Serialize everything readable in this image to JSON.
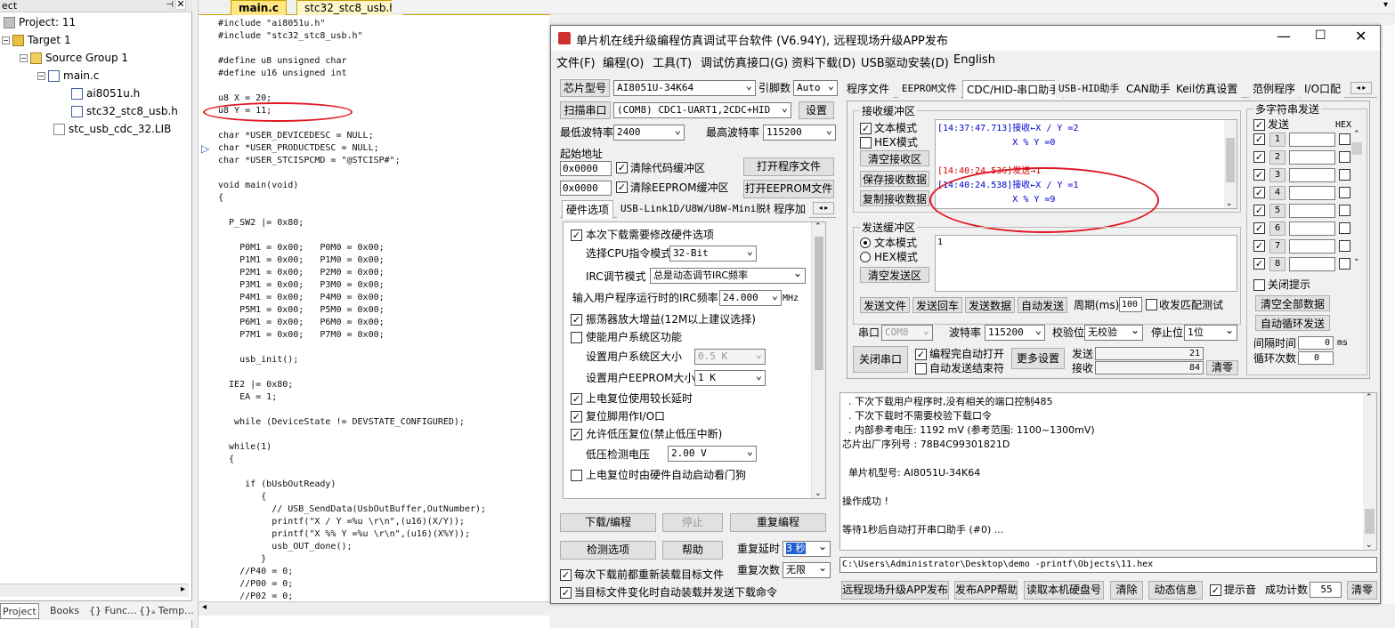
{
  "project": {
    "header": "ect",
    "items": [
      "Project: 11",
      "Target 1",
      "Source Group 1",
      "main.c",
      "ai8051u.h",
      "stc32_stc8_usb.h",
      "stc_usb_cdc_32.LIB"
    ],
    "tabs": [
      "Project",
      "Books",
      "{} Func...",
      "{}ₐ Temp..."
    ]
  },
  "editor": {
    "tabs": [
      "main.c",
      "stc32_stc8_usb.h"
    ],
    "lines": [
      "#include \"ai8051u.h\"",
      "#include \"stc32_stc8_usb.h\"",
      "",
      "#define u8 unsigned char",
      "#define u16 unsigned int",
      "",
      "u8 X = 20;",
      "u8 Y = 11;",
      "",
      "char *USER_DEVICEDESC = NULL;",
      "char *USER_PRODUCTDESC = NULL;",
      "char *USER_STCISPCMD = \"@STCISP#\";",
      "",
      "void main(void)",
      "{",
      "",
      "  P_SW2 |= 0x80;",
      "",
      "    P0M1 = 0x00;   P0M0 = 0x00;",
      "    P1M1 = 0x00;   P1M0 = 0x00;",
      "    P2M1 = 0x00;   P2M0 = 0x00;",
      "    P3M1 = 0x00;   P3M0 = 0x00;",
      "    P4M1 = 0x00;   P4M0 = 0x00;",
      "    P5M1 = 0x00;   P5M0 = 0x00;",
      "    P6M1 = 0x00;   P6M0 = 0x00;",
      "    P7M1 = 0x00;   P7M0 = 0x00;",
      "",
      "    usb_init();",
      "",
      "  IE2 |= 0x80;",
      "    EA = 1;",
      "",
      "   while (DeviceState != DEVSTATE_CONFIGURED);",
      "",
      "  while(1)",
      "  {",
      "",
      "     if (bUsbOutReady)",
      "        {",
      "          // USB_SendData(UsbOutBuffer,OutNumber);",
      "          printf(\"X / Y =%u \\r\\n\",(u16)(X/Y));",
      "          printf(\"X %% Y =%u \\r\\n\",(u16)(X%Y));",
      "          usb_OUT_done();",
      "        }",
      "    //P40 = 0;",
      "    //P00 = 0;",
      "    //P02 = 0;"
    ]
  },
  "window": {
    "title": "单片机在线升级编程仿真调试平台软件 (V6.94Y), 远程现场升级APP发布",
    "menus": [
      "文件(F)",
      "编程(O)",
      "工具(T)",
      "调试仿真接口(G)",
      "资料下载(D)",
      "USB驱动安装(D)",
      "English"
    ]
  },
  "left": {
    "chip_label": "芯片型号",
    "chip": "AI8051U-34K64",
    "pins_label": "引脚数",
    "pins": "Auto",
    "scan_btn": "扫描串口",
    "port": "(COM8) CDC1-UART1,2CDC+HID",
    "settings_btn": "设置",
    "min_baud_label": "最低波特率",
    "min_baud": "2400",
    "max_baud_label": "最高波特率",
    "max_baud": "115200",
    "start_label": "起始地址",
    "addr1": "0x0000",
    "clear_code": "清除代码缓冲区",
    "open_prog": "打开程序文件",
    "addr2": "0x0000",
    "clear_eeprom": "清除EEPROM缓冲区",
    "open_eeprom": "打开EEPROM文件",
    "tabs": [
      "硬件选项",
      "USB-Link1D/U8W/U8W-Mini脱机",
      "程序加"
    ],
    "hw": {
      "opt1": "本次下载需要修改硬件选项",
      "cpu_label": "选择CPU指令模式",
      "cpu": "32-Bit",
      "irc_label": "IRC调节模式",
      "irc": "总是动态调节IRC频率",
      "freq_label": "输入用户程序运行时的IRC频率",
      "freq": "24.000",
      "freq_unit": "MHz",
      "osc": "振荡器放大增益(12M以上建议选择)",
      "sysarea": "使能用户系统区功能",
      "sys_size_label": "设置用户系统区大小",
      "sys_size": "0.5 K",
      "eeprom_label": "设置用户EEPROM大小",
      "eeprom": "1   K",
      "power_delay": "上电复位使用较长延时",
      "reset_io": "复位脚用作I/O口",
      "lowv": "允许低压复位(禁止低压中断)",
      "lowv_label": "低压检测电压",
      "lowv_val": "2.00 V",
      "watchdog": "上电复位时由硬件自动启动看门狗"
    },
    "download_btn": "下载/编程",
    "stop_btn": "停止",
    "reprog_btn": "重复编程",
    "check_btn": "检测选项",
    "help_btn": "帮助",
    "delay_label": "重复延时",
    "delay": "3 秒",
    "count_label": "重复次数",
    "count": "无限",
    "reload1": "每次下载前都重新装载目标文件",
    "reload2": "当目标文件变化时自动装载并发送下载命令"
  },
  "right": {
    "tabs": [
      "程序文件",
      "EEPROM文件",
      "CDC/HID-串口助手",
      "USB-HID助手",
      "CAN助手",
      "Keil仿真设置",
      "范例程序",
      "I/O口配"
    ],
    "recv_group": "接收缓冲区",
    "text_mode": "文本模式",
    "hex_mode": "HEX模式",
    "clear_recv": "清空接收区",
    "save_recv": "保存接收数据",
    "copy_recv": "复制接收数据",
    "recv_lines": [
      {
        "text": "[14:37:47.713]接收←X / Y =2",
        "color": "#0000cc"
      },
      {
        "text": "              X % Y =0",
        "color": "#0000cc"
      },
      {
        "text": "",
        "color": "#000"
      },
      {
        "text": "[14:40:24.536]发送→1",
        "color": "#cc0000"
      },
      {
        "text": "[14:40:24.538]接收←X / Y =1",
        "color": "#0000cc"
      },
      {
        "text": "              X % Y =9",
        "color": "#0000cc"
      }
    ],
    "send_group": "发送缓冲区",
    "clear_send": "清空发送区",
    "send_text": "1",
    "send_file": "发送文件",
    "send_enter": "发送回车",
    "send_data": "发送数据",
    "auto_send": "自动发送",
    "period_label": "周期(ms)",
    "period": "100",
    "match_test": "收发匹配测试",
    "port_label": "串口",
    "port": "COM8",
    "baud_label": "波特率",
    "baud": "115200",
    "parity_label": "校验位",
    "parity": "无校验",
    "stop_label": "停止位",
    "stop": "1位",
    "close_port": "关闭串口",
    "auto_open": "编程完自动打开",
    "auto_close": "自动发送结束符",
    "more": "更多设置",
    "sent_label": "发送",
    "sent": "21",
    "recv_label": "接收",
    "recv": "84",
    "clear_count": "清零",
    "multi_title": "多字符串发送",
    "multi_send": "发送",
    "hex": "HEX",
    "rows": [
      "1",
      "2",
      "3",
      "4",
      "5",
      "6",
      "7",
      "8"
    ],
    "close_tip": "关闭提示",
    "clear_all": "清空全部数据",
    "auto_loop": "自动循环发送",
    "interval_label": "间隔时间",
    "interval": "0",
    "ms": "ms",
    "loop_label": "循环次数",
    "loop": "0",
    "log": [
      "  . 下次下载用户程序时,没有相关的端口控制485",
      "  . 下次下载时不需要校验下载口令",
      "  . 内部参考电压: 1192 mV (参考范围: 1100~1300mV)",
      "芯片出厂序列号 : 78B4C99301821D",
      "",
      "  单片机型号: AI8051U-34K64",
      "",
      "操作成功 !",
      "",
      "等待1秒后自动打开串口助手 (#0) ..."
    ],
    "path": "C:\\Users\\Administrator\\Desktop\\demo -printf\\Objects\\11.hex",
    "bottom": {
      "publish": "远程现场升级APP发布",
      "app_help": "发布APP帮助",
      "read_disk": "读取本机硬盘号",
      "clear": "清除",
      "dynamic": "动态信息",
      "sound": "提示音",
      "success_label": "成功计数",
      "success": "55",
      "reset": "清零"
    }
  }
}
